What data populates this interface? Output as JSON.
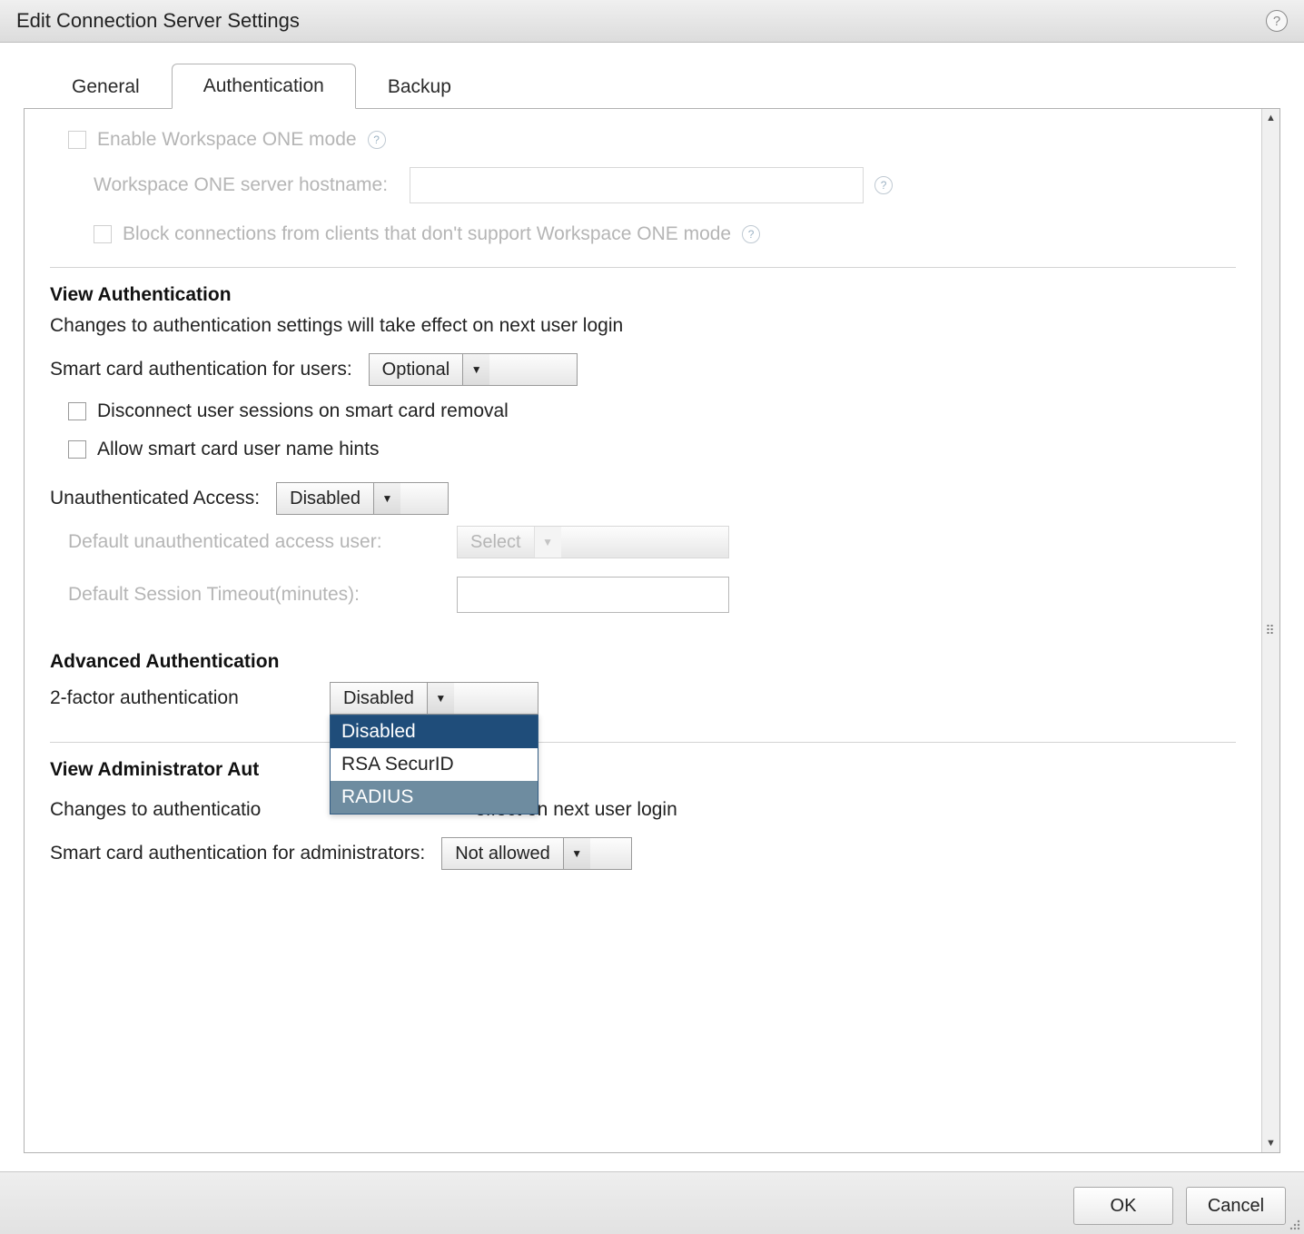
{
  "dialog": {
    "title": "Edit Connection Server Settings"
  },
  "tabs": {
    "general": "General",
    "authentication": "Authentication",
    "backup": "Backup"
  },
  "workspaceOne": {
    "enable_label": "Enable Workspace ONE mode",
    "hostname_label": "Workspace ONE server hostname:",
    "hostname_value": "",
    "block_label": "Block connections from clients that don't support Workspace ONE mode"
  },
  "viewAuth": {
    "heading": "View Authentication",
    "desc": "Changes to authentication settings will take effect on next user login",
    "smartcard_label": "Smart card authentication for users:",
    "smartcard_value": "Optional",
    "disconnect_label": "Disconnect user sessions on smart card removal",
    "hints_label": "Allow smart card user name hints",
    "unauth_label": "Unauthenticated Access:",
    "unauth_value": "Disabled",
    "default_user_label": "Default unauthenticated access user:",
    "default_user_value": "Select",
    "timeout_label": "Default Session Timeout(minutes):",
    "timeout_value": ""
  },
  "advAuth": {
    "heading": "Advanced Authentication",
    "twofactor_label": "2-factor authentication",
    "twofactor_value": "Disabled",
    "options": {
      "disabled": "Disabled",
      "rsa": "RSA SecurID",
      "radius": "RADIUS"
    }
  },
  "adminAuth": {
    "heading_partial": "View Administrator Aut",
    "desc_prefix": "Changes to authenticatio",
    "desc_suffix": " effect on next user login",
    "smartcard_label": "Smart card authentication for administrators:",
    "smartcard_value": "Not allowed"
  },
  "buttons": {
    "ok": "OK",
    "cancel": "Cancel"
  }
}
